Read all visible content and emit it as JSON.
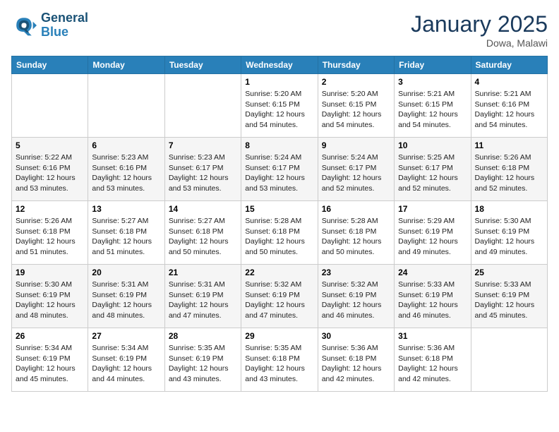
{
  "header": {
    "logo_line1": "General",
    "logo_line2": "Blue",
    "month": "January 2025",
    "location": "Dowa, Malawi"
  },
  "days_of_week": [
    "Sunday",
    "Monday",
    "Tuesday",
    "Wednesday",
    "Thursday",
    "Friday",
    "Saturday"
  ],
  "weeks": [
    [
      {
        "day": "",
        "info": ""
      },
      {
        "day": "",
        "info": ""
      },
      {
        "day": "",
        "info": ""
      },
      {
        "day": "1",
        "info": "Sunrise: 5:20 AM\nSunset: 6:15 PM\nDaylight: 12 hours\nand 54 minutes."
      },
      {
        "day": "2",
        "info": "Sunrise: 5:20 AM\nSunset: 6:15 PM\nDaylight: 12 hours\nand 54 minutes."
      },
      {
        "day": "3",
        "info": "Sunrise: 5:21 AM\nSunset: 6:15 PM\nDaylight: 12 hours\nand 54 minutes."
      },
      {
        "day": "4",
        "info": "Sunrise: 5:21 AM\nSunset: 6:16 PM\nDaylight: 12 hours\nand 54 minutes."
      }
    ],
    [
      {
        "day": "5",
        "info": "Sunrise: 5:22 AM\nSunset: 6:16 PM\nDaylight: 12 hours\nand 53 minutes."
      },
      {
        "day": "6",
        "info": "Sunrise: 5:23 AM\nSunset: 6:16 PM\nDaylight: 12 hours\nand 53 minutes."
      },
      {
        "day": "7",
        "info": "Sunrise: 5:23 AM\nSunset: 6:17 PM\nDaylight: 12 hours\nand 53 minutes."
      },
      {
        "day": "8",
        "info": "Sunrise: 5:24 AM\nSunset: 6:17 PM\nDaylight: 12 hours\nand 53 minutes."
      },
      {
        "day": "9",
        "info": "Sunrise: 5:24 AM\nSunset: 6:17 PM\nDaylight: 12 hours\nand 52 minutes."
      },
      {
        "day": "10",
        "info": "Sunrise: 5:25 AM\nSunset: 6:17 PM\nDaylight: 12 hours\nand 52 minutes."
      },
      {
        "day": "11",
        "info": "Sunrise: 5:26 AM\nSunset: 6:18 PM\nDaylight: 12 hours\nand 52 minutes."
      }
    ],
    [
      {
        "day": "12",
        "info": "Sunrise: 5:26 AM\nSunset: 6:18 PM\nDaylight: 12 hours\nand 51 minutes."
      },
      {
        "day": "13",
        "info": "Sunrise: 5:27 AM\nSunset: 6:18 PM\nDaylight: 12 hours\nand 51 minutes."
      },
      {
        "day": "14",
        "info": "Sunrise: 5:27 AM\nSunset: 6:18 PM\nDaylight: 12 hours\nand 50 minutes."
      },
      {
        "day": "15",
        "info": "Sunrise: 5:28 AM\nSunset: 6:18 PM\nDaylight: 12 hours\nand 50 minutes."
      },
      {
        "day": "16",
        "info": "Sunrise: 5:28 AM\nSunset: 6:18 PM\nDaylight: 12 hours\nand 50 minutes."
      },
      {
        "day": "17",
        "info": "Sunrise: 5:29 AM\nSunset: 6:19 PM\nDaylight: 12 hours\nand 49 minutes."
      },
      {
        "day": "18",
        "info": "Sunrise: 5:30 AM\nSunset: 6:19 PM\nDaylight: 12 hours\nand 49 minutes."
      }
    ],
    [
      {
        "day": "19",
        "info": "Sunrise: 5:30 AM\nSunset: 6:19 PM\nDaylight: 12 hours\nand 48 minutes."
      },
      {
        "day": "20",
        "info": "Sunrise: 5:31 AM\nSunset: 6:19 PM\nDaylight: 12 hours\nand 48 minutes."
      },
      {
        "day": "21",
        "info": "Sunrise: 5:31 AM\nSunset: 6:19 PM\nDaylight: 12 hours\nand 47 minutes."
      },
      {
        "day": "22",
        "info": "Sunrise: 5:32 AM\nSunset: 6:19 PM\nDaylight: 12 hours\nand 47 minutes."
      },
      {
        "day": "23",
        "info": "Sunrise: 5:32 AM\nSunset: 6:19 PM\nDaylight: 12 hours\nand 46 minutes."
      },
      {
        "day": "24",
        "info": "Sunrise: 5:33 AM\nSunset: 6:19 PM\nDaylight: 12 hours\nand 46 minutes."
      },
      {
        "day": "25",
        "info": "Sunrise: 5:33 AM\nSunset: 6:19 PM\nDaylight: 12 hours\nand 45 minutes."
      }
    ],
    [
      {
        "day": "26",
        "info": "Sunrise: 5:34 AM\nSunset: 6:19 PM\nDaylight: 12 hours\nand 45 minutes."
      },
      {
        "day": "27",
        "info": "Sunrise: 5:34 AM\nSunset: 6:19 PM\nDaylight: 12 hours\nand 44 minutes."
      },
      {
        "day": "28",
        "info": "Sunrise: 5:35 AM\nSunset: 6:19 PM\nDaylight: 12 hours\nand 43 minutes."
      },
      {
        "day": "29",
        "info": "Sunrise: 5:35 AM\nSunset: 6:18 PM\nDaylight: 12 hours\nand 43 minutes."
      },
      {
        "day": "30",
        "info": "Sunrise: 5:36 AM\nSunset: 6:18 PM\nDaylight: 12 hours\nand 42 minutes."
      },
      {
        "day": "31",
        "info": "Sunrise: 5:36 AM\nSunset: 6:18 PM\nDaylight: 12 hours\nand 42 minutes."
      },
      {
        "day": "",
        "info": ""
      }
    ]
  ]
}
